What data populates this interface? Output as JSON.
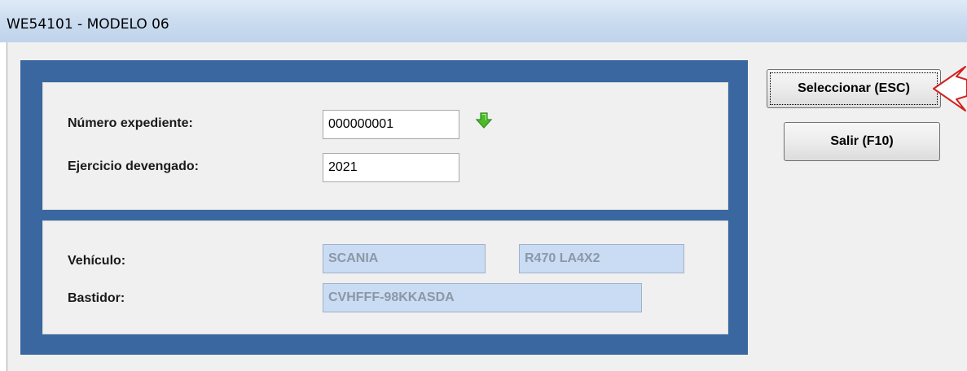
{
  "window": {
    "title": "WE54101 - MODELO 06"
  },
  "form": {
    "numero_expediente": {
      "label": "Número expediente:",
      "value": "000000001"
    },
    "ejercicio_devengado": {
      "label": "Ejercicio devengado:",
      "value": "2021"
    },
    "vehiculo": {
      "label": "Vehículo:",
      "marca": "SCANIA",
      "modelo": "R470 LA4X2"
    },
    "bastidor": {
      "label": "Bastidor:",
      "value": "CVHFFF-98KKASDA"
    }
  },
  "buttons": {
    "seleccionar": "Seleccionar (ESC)",
    "salir": "Salir (F10)"
  },
  "colors": {
    "frame_blue": "#3a67a0",
    "readonly_field": "#c9dcf4",
    "arrow_green": "#4cbb2a",
    "pointer_red": "#d42020"
  },
  "icons": {
    "lookup": "green-down-arrow",
    "pointer": "red-left-arrow-outline"
  }
}
